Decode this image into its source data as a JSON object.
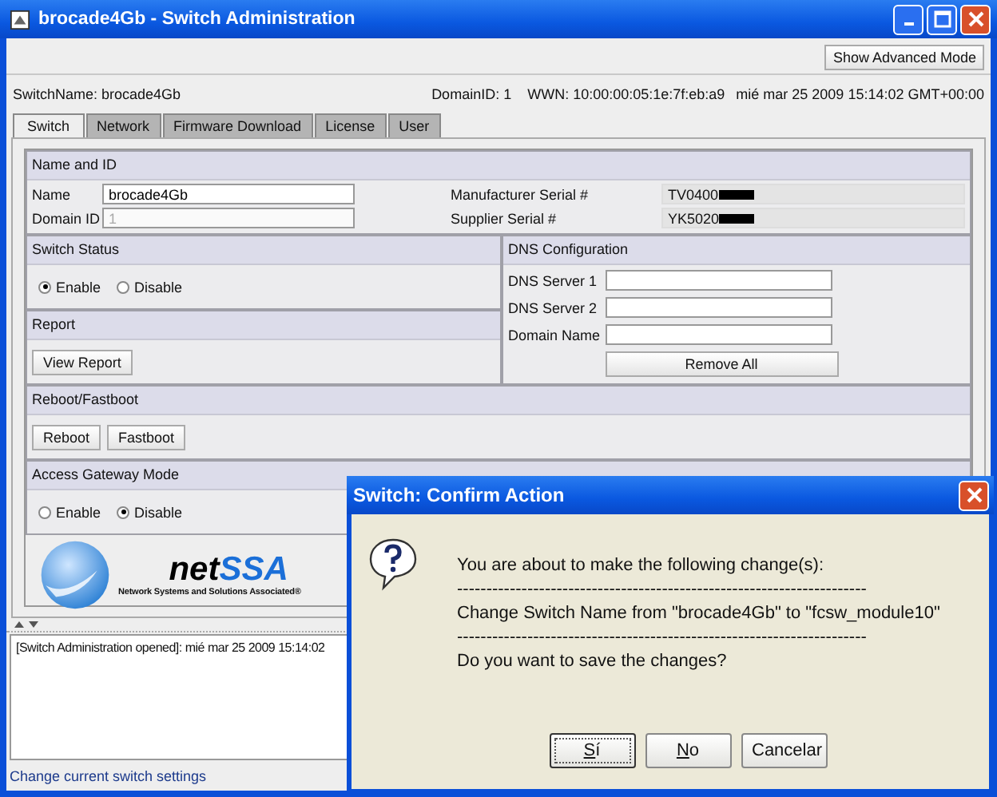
{
  "window": {
    "title": "brocade4Gb - Switch Administration"
  },
  "toolbar": {
    "button": "Show Advanced Mode"
  },
  "info_bar": {
    "switch_name": "SwitchName: brocade4Gb",
    "domain_id": "DomainID: 1",
    "wwn": "WWN: 10:00:00:05:1e:7f:eb:a9",
    "datetime": "mié mar 25 2009 15:14:02 GMT+00:00"
  },
  "tabs": [
    {
      "label": "Switch",
      "selected": true
    },
    {
      "label": "Network",
      "selected": false
    },
    {
      "label": "Firmware Download",
      "selected": false
    },
    {
      "label": "License",
      "selected": false
    },
    {
      "label": "User",
      "selected": false
    }
  ],
  "name_and_id": {
    "title": "Name and ID",
    "name_label": "Name",
    "name_value": "brocade4Gb",
    "domain_label": "Domain ID",
    "domain_value": "1",
    "domain_disabled": true,
    "manufacturer_label": "Manufacturer Serial #",
    "manufacturer_value": "TV0400",
    "supplier_label": "Supplier Serial #",
    "supplier_value": "YK5020"
  },
  "switch_status": {
    "title": "Switch Status",
    "options": [
      {
        "label": "Enable",
        "selected": true
      },
      {
        "label": "Disable",
        "selected": false
      }
    ]
  },
  "report": {
    "title": "Report",
    "button": "View Report"
  },
  "dns": {
    "title": "DNS Configuration",
    "fields": [
      {
        "label": "DNS Server 1"
      },
      {
        "label": "DNS Server 2"
      },
      {
        "label": "Domain Name"
      }
    ],
    "button": "Remove All"
  },
  "reboot": {
    "title": "Reboot/Fastboot",
    "buttons": [
      "Reboot",
      "Fastboot"
    ]
  },
  "access_gateway": {
    "title": "Access Gateway Mode",
    "options": [
      {
        "label": "Enable",
        "selected": false
      },
      {
        "label": "Disable",
        "selected": true
      }
    ]
  },
  "logo": {
    "word1": "net",
    "word2": "SSA",
    "tagline": "Network Systems and Solutions Associated®"
  },
  "log": {
    "lines": [
      "[Switch Administration opened]: mié mar 25 2009 15:14:02"
    ]
  },
  "status_bar": "Change current switch settings",
  "dialog": {
    "title": "Switch: Confirm Action",
    "lines": [
      {
        "kind": "text",
        "text": "You are about to make the following change(s):"
      },
      {
        "kind": "text",
        "text": "----------------------------------------------------------------------"
      },
      {
        "kind": "text",
        "text": "Change Switch Name from \"brocade4Gb\" to \"fcsw_module10\""
      },
      {
        "kind": "text",
        "text": "----------------------------------------------------------------------"
      },
      {
        "kind": "text",
        "text": "Do you want to save the changes?"
      }
    ],
    "buttons": [
      {
        "label": "Sí",
        "mnemonic": true,
        "focused": true
      },
      {
        "label": "No",
        "mnemonic": true,
        "focused": false
      },
      {
        "label": "Cancelar",
        "mnemonic": false,
        "focused": false
      }
    ]
  }
}
